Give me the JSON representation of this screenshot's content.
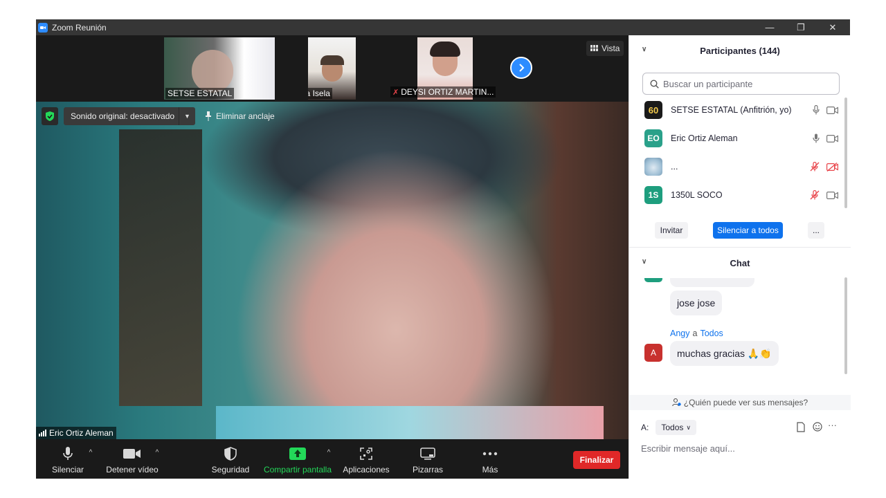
{
  "window": {
    "title": "Zoom Reunión",
    "controls": {
      "minimize": "—",
      "restore": "❐",
      "close": "✕"
    }
  },
  "strip": {
    "thumbs": [
      {
        "name": "SETSE ESTATAL",
        "muted": false
      },
      {
        "name": "Rosa Isela",
        "muted": true
      },
      {
        "name": "DEYSI ORTIZ MARTIN...",
        "muted": true
      }
    ],
    "view_label": "Vista"
  },
  "main_video": {
    "sound_label": "Sonido original: desactivado",
    "unpin_label": "Eliminar anclaje",
    "speaker": "Eric Ortiz Aleman"
  },
  "toolbar": {
    "mute": "Silenciar",
    "stop_video": "Detener vídeo",
    "security": "Seguridad",
    "share": "Compartir pantalla",
    "apps": "Aplicaciones",
    "whiteboards": "Pizarras",
    "more": "Más",
    "end": "Finalizar"
  },
  "participants": {
    "header": "Participantes (144)",
    "search_placeholder": "Buscar un participante",
    "list": [
      {
        "avatar_text": "60",
        "avatar_color": "#1a1a1a",
        "name": "SETSE ESTATAL (Anfitrión, yo)",
        "mic_muted": false,
        "video_off": false
      },
      {
        "avatar_text": "EO",
        "avatar_color": "#2aa18a",
        "name": "Eric Ortiz Aleman",
        "mic_muted": false,
        "video_off": false
      },
      {
        "avatar_text": "",
        "avatar_color": "#8fb3c9",
        "name": "...",
        "mic_muted": true,
        "video_off": true
      },
      {
        "avatar_text": "1S",
        "avatar_color": "#1e9e7e",
        "name": "1350L SOCO",
        "mic_muted": true,
        "video_off": false
      }
    ],
    "invite": "Invitar",
    "mute_all": "Silenciar a todos",
    "more": "..."
  },
  "chat": {
    "header": "Chat",
    "messages": [
      {
        "text": "jose jose"
      },
      {
        "sender": "Angy",
        "to_word": "a",
        "recipient": "Todos",
        "avatar_text": "A",
        "avatar_color": "#c8312e",
        "text": "muchas gracias 🙏👏"
      }
    ],
    "who_sees": "¿Quién puede ver sus mensajes?",
    "to_label": "A:",
    "to_value": "Todos",
    "input_placeholder": "Escribir mensaje aquí..."
  },
  "colors": {
    "accent": "#0e72ed",
    "share_green": "#23d959",
    "end_red": "#e02828",
    "muted_red": "#e8444a"
  }
}
